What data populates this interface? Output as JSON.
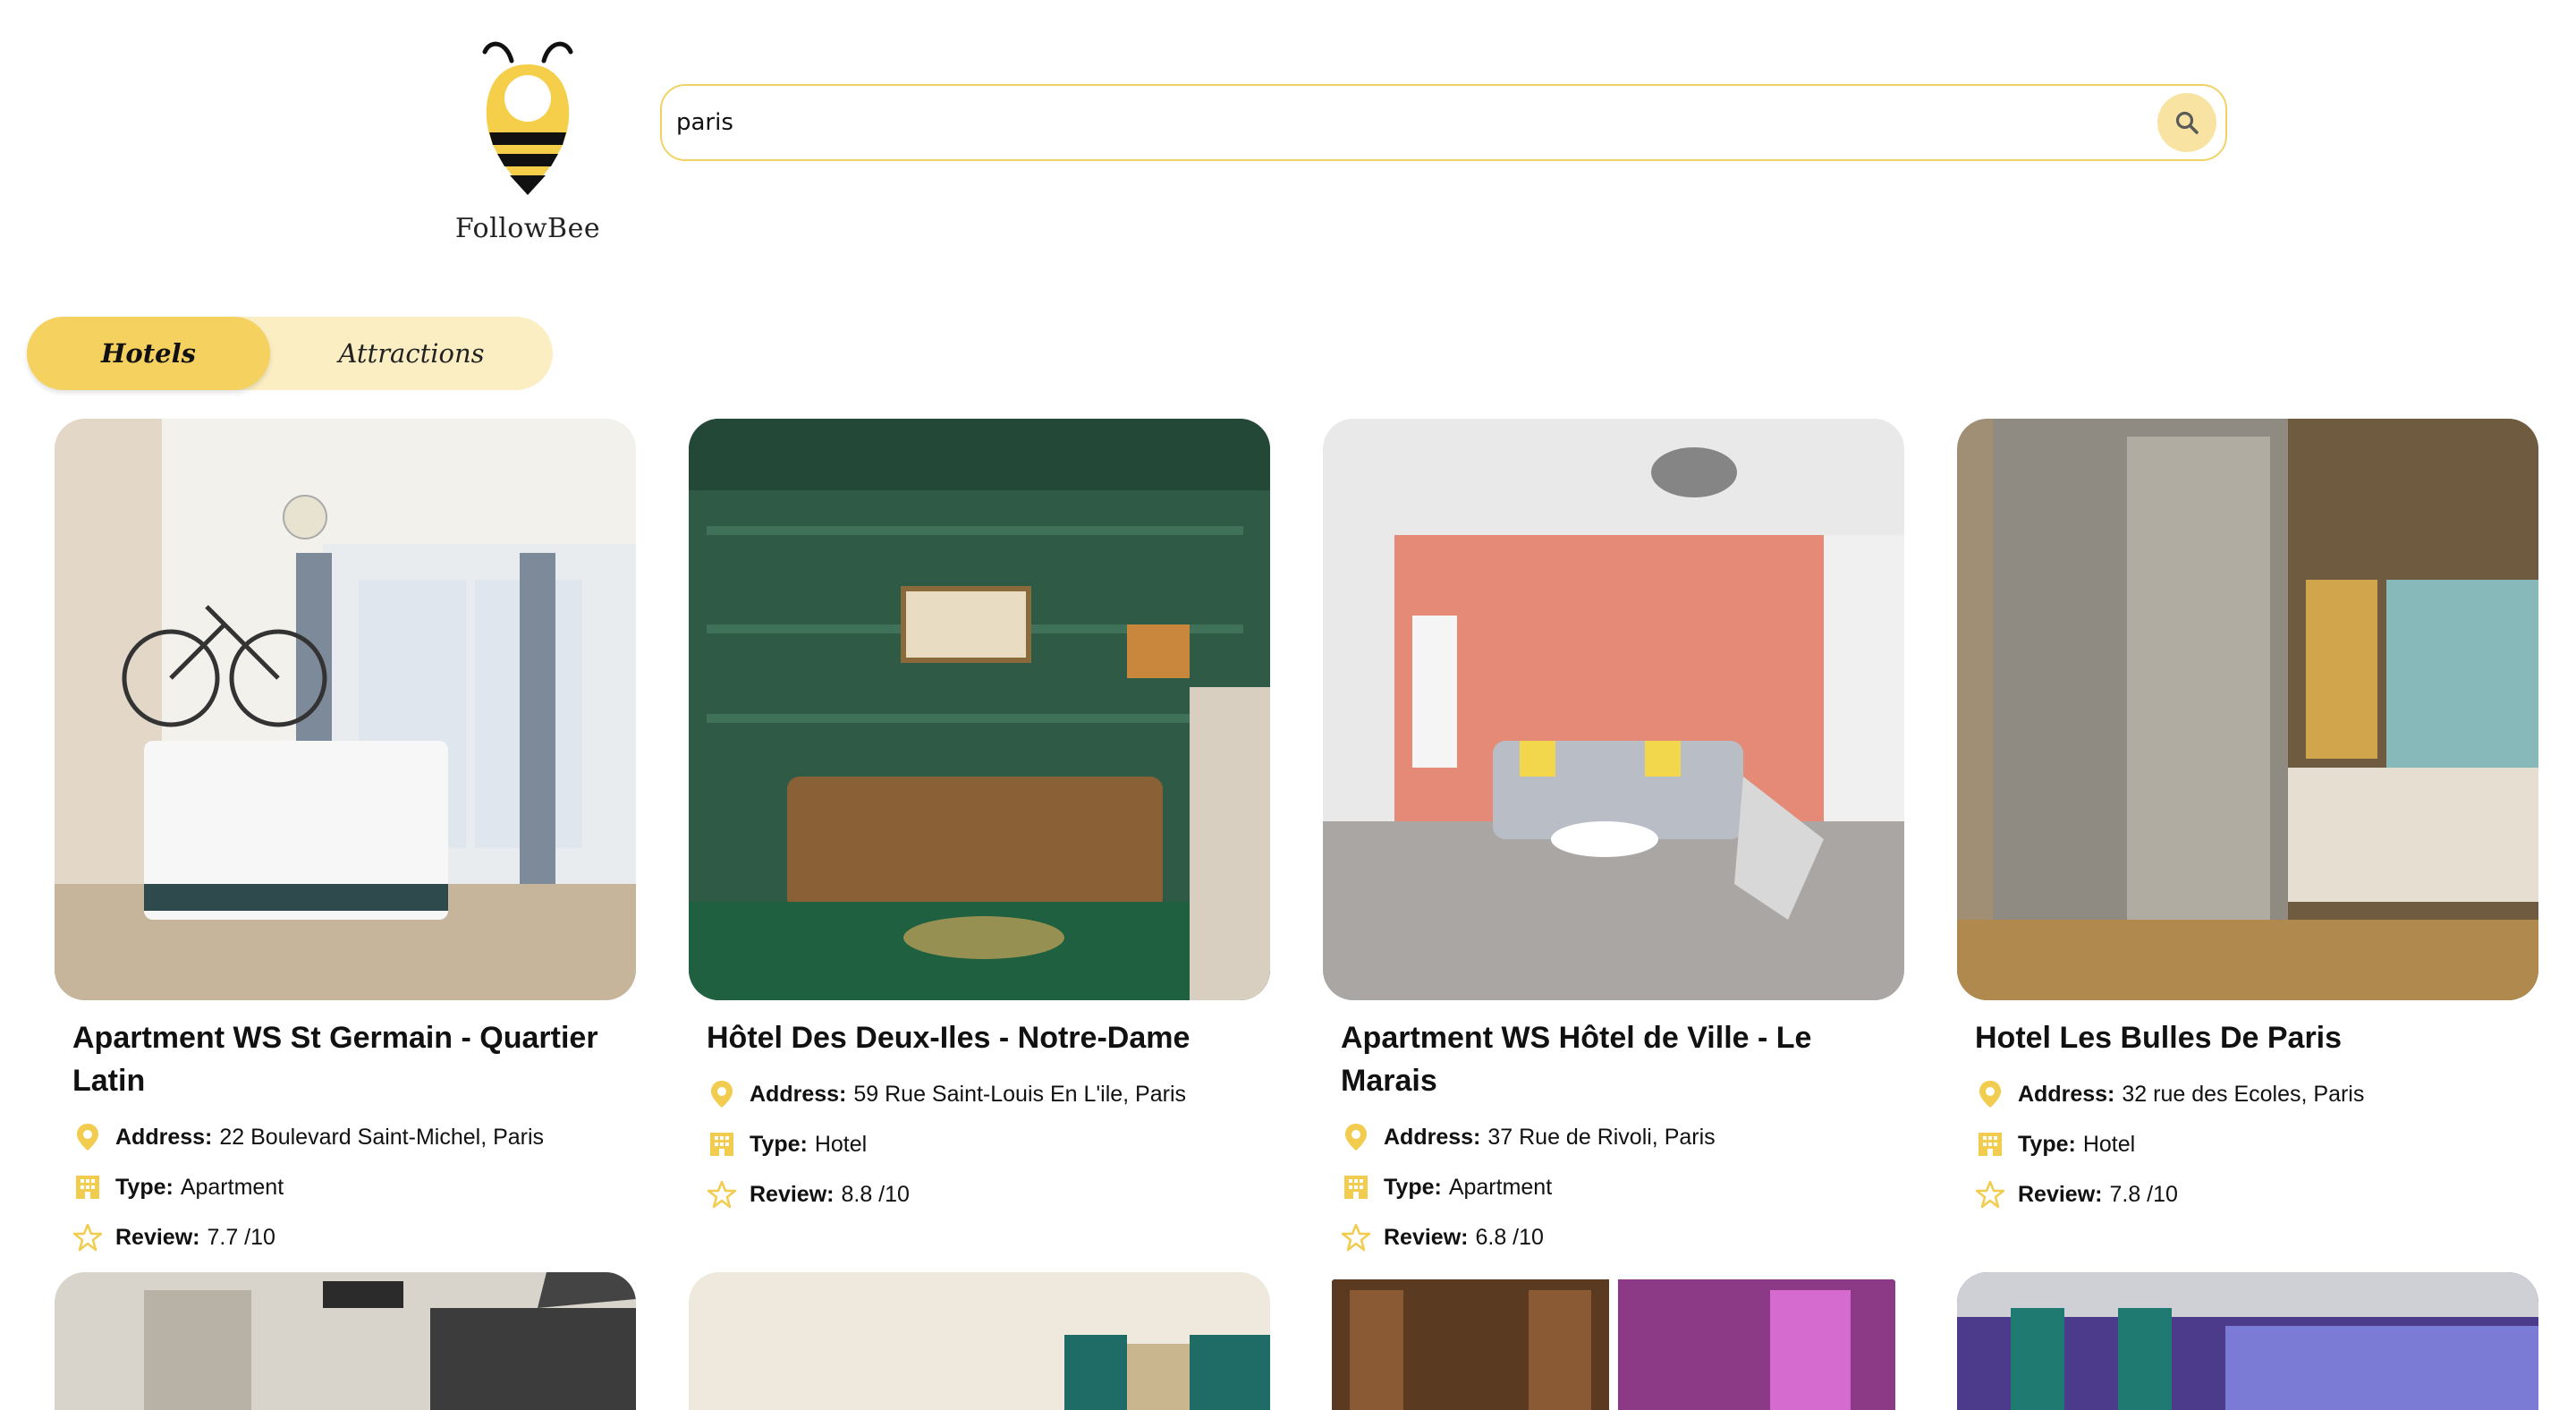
{
  "brand": {
    "name": "FollowBee"
  },
  "search": {
    "value": "paris",
    "placeholder": ""
  },
  "tabs": [
    {
      "label": "Hotels",
      "active": true
    },
    {
      "label": "Attractions",
      "active": false
    }
  ],
  "labels": {
    "address": "Address:",
    "type": "Type:",
    "review": "Review:"
  },
  "hotels": [
    {
      "name": "Apartment WS St Germain - Quartier Latin",
      "address": "22 Boulevard Saint-Michel, Paris",
      "type": "Apartment",
      "review": "7.7 /10"
    },
    {
      "name": "Hôtel Des Deux-Iles - Notre-Dame",
      "address": "59 Rue Saint-Louis En L'ile, Paris",
      "type": "Hotel",
      "review": "8.8 /10"
    },
    {
      "name": "Apartment WS Hôtel de Ville - Le Marais",
      "address": "37 Rue de Rivoli, Paris",
      "type": "Apartment",
      "review": "6.8 /10"
    },
    {
      "name": "Hotel Les Bulles De Paris",
      "address": "32 rue des Ecoles, Paris",
      "type": "Hotel",
      "review": "7.8 /10"
    }
  ],
  "colors": {
    "accent": "#f5d160",
    "accent_light": "#fbeec3",
    "icon": "#f2cc4e",
    "search_border": "#f1d264"
  },
  "icons": {
    "search": "magnifier-icon",
    "address": "map-pin-icon",
    "type": "building-icon",
    "review": "star-outline-icon"
  }
}
